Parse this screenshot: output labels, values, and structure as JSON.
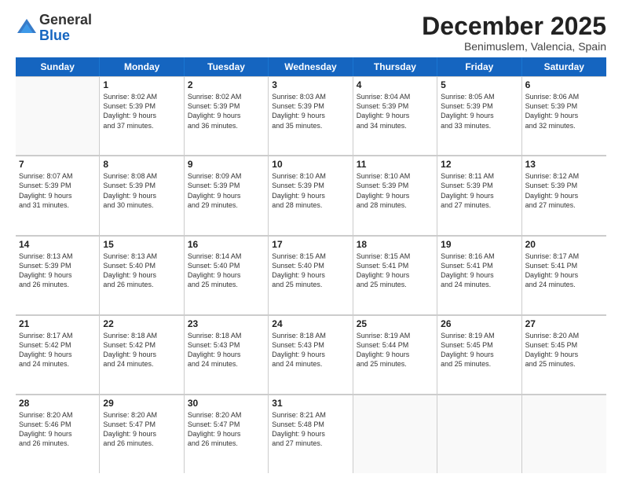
{
  "header": {
    "logo_general": "General",
    "logo_blue": "Blue",
    "month_title": "December 2025",
    "location": "Benimuslem, Valencia, Spain"
  },
  "days_of_week": [
    "Sunday",
    "Monday",
    "Tuesday",
    "Wednesday",
    "Thursday",
    "Friday",
    "Saturday"
  ],
  "weeks": [
    [
      {
        "day": "",
        "info": ""
      },
      {
        "day": "1",
        "info": "Sunrise: 8:02 AM\nSunset: 5:39 PM\nDaylight: 9 hours\nand 37 minutes."
      },
      {
        "day": "2",
        "info": "Sunrise: 8:02 AM\nSunset: 5:39 PM\nDaylight: 9 hours\nand 36 minutes."
      },
      {
        "day": "3",
        "info": "Sunrise: 8:03 AM\nSunset: 5:39 PM\nDaylight: 9 hours\nand 35 minutes."
      },
      {
        "day": "4",
        "info": "Sunrise: 8:04 AM\nSunset: 5:39 PM\nDaylight: 9 hours\nand 34 minutes."
      },
      {
        "day": "5",
        "info": "Sunrise: 8:05 AM\nSunset: 5:39 PM\nDaylight: 9 hours\nand 33 minutes."
      },
      {
        "day": "6",
        "info": "Sunrise: 8:06 AM\nSunset: 5:39 PM\nDaylight: 9 hours\nand 32 minutes."
      }
    ],
    [
      {
        "day": "7",
        "info": "Sunrise: 8:07 AM\nSunset: 5:39 PM\nDaylight: 9 hours\nand 31 minutes."
      },
      {
        "day": "8",
        "info": "Sunrise: 8:08 AM\nSunset: 5:39 PM\nDaylight: 9 hours\nand 30 minutes."
      },
      {
        "day": "9",
        "info": "Sunrise: 8:09 AM\nSunset: 5:39 PM\nDaylight: 9 hours\nand 29 minutes."
      },
      {
        "day": "10",
        "info": "Sunrise: 8:10 AM\nSunset: 5:39 PM\nDaylight: 9 hours\nand 28 minutes."
      },
      {
        "day": "11",
        "info": "Sunrise: 8:10 AM\nSunset: 5:39 PM\nDaylight: 9 hours\nand 28 minutes."
      },
      {
        "day": "12",
        "info": "Sunrise: 8:11 AM\nSunset: 5:39 PM\nDaylight: 9 hours\nand 27 minutes."
      },
      {
        "day": "13",
        "info": "Sunrise: 8:12 AM\nSunset: 5:39 PM\nDaylight: 9 hours\nand 27 minutes."
      }
    ],
    [
      {
        "day": "14",
        "info": "Sunrise: 8:13 AM\nSunset: 5:39 PM\nDaylight: 9 hours\nand 26 minutes."
      },
      {
        "day": "15",
        "info": "Sunrise: 8:13 AM\nSunset: 5:40 PM\nDaylight: 9 hours\nand 26 minutes."
      },
      {
        "day": "16",
        "info": "Sunrise: 8:14 AM\nSunset: 5:40 PM\nDaylight: 9 hours\nand 25 minutes."
      },
      {
        "day": "17",
        "info": "Sunrise: 8:15 AM\nSunset: 5:40 PM\nDaylight: 9 hours\nand 25 minutes."
      },
      {
        "day": "18",
        "info": "Sunrise: 8:15 AM\nSunset: 5:41 PM\nDaylight: 9 hours\nand 25 minutes."
      },
      {
        "day": "19",
        "info": "Sunrise: 8:16 AM\nSunset: 5:41 PM\nDaylight: 9 hours\nand 24 minutes."
      },
      {
        "day": "20",
        "info": "Sunrise: 8:17 AM\nSunset: 5:41 PM\nDaylight: 9 hours\nand 24 minutes."
      }
    ],
    [
      {
        "day": "21",
        "info": "Sunrise: 8:17 AM\nSunset: 5:42 PM\nDaylight: 9 hours\nand 24 minutes."
      },
      {
        "day": "22",
        "info": "Sunrise: 8:18 AM\nSunset: 5:42 PM\nDaylight: 9 hours\nand 24 minutes."
      },
      {
        "day": "23",
        "info": "Sunrise: 8:18 AM\nSunset: 5:43 PM\nDaylight: 9 hours\nand 24 minutes."
      },
      {
        "day": "24",
        "info": "Sunrise: 8:18 AM\nSunset: 5:43 PM\nDaylight: 9 hours\nand 24 minutes."
      },
      {
        "day": "25",
        "info": "Sunrise: 8:19 AM\nSunset: 5:44 PM\nDaylight: 9 hours\nand 25 minutes."
      },
      {
        "day": "26",
        "info": "Sunrise: 8:19 AM\nSunset: 5:45 PM\nDaylight: 9 hours\nand 25 minutes."
      },
      {
        "day": "27",
        "info": "Sunrise: 8:20 AM\nSunset: 5:45 PM\nDaylight: 9 hours\nand 25 minutes."
      }
    ],
    [
      {
        "day": "28",
        "info": "Sunrise: 8:20 AM\nSunset: 5:46 PM\nDaylight: 9 hours\nand 26 minutes."
      },
      {
        "day": "29",
        "info": "Sunrise: 8:20 AM\nSunset: 5:47 PM\nDaylight: 9 hours\nand 26 minutes."
      },
      {
        "day": "30",
        "info": "Sunrise: 8:20 AM\nSunset: 5:47 PM\nDaylight: 9 hours\nand 26 minutes."
      },
      {
        "day": "31",
        "info": "Sunrise: 8:21 AM\nSunset: 5:48 PM\nDaylight: 9 hours\nand 27 minutes."
      },
      {
        "day": "",
        "info": ""
      },
      {
        "day": "",
        "info": ""
      },
      {
        "day": "",
        "info": ""
      }
    ]
  ]
}
